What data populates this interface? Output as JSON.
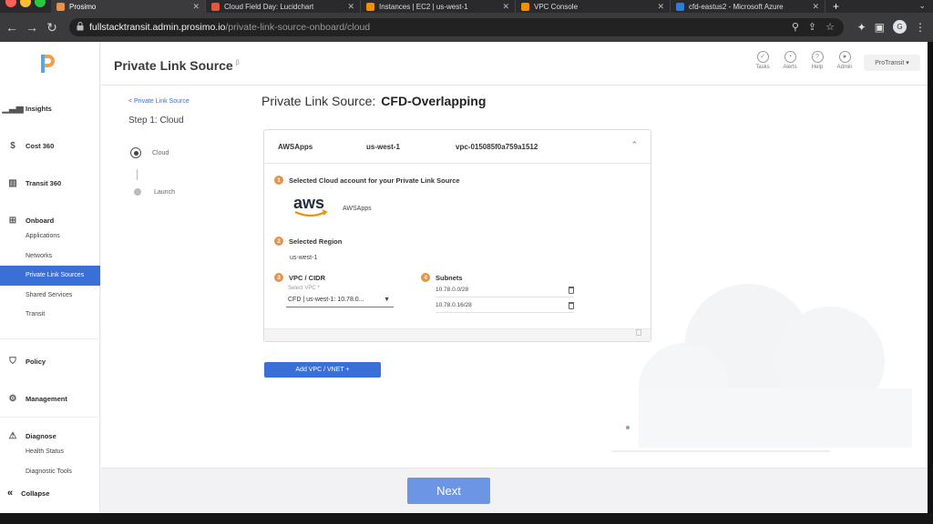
{
  "browser": {
    "tabs": [
      {
        "label": "Prosimo",
        "color": "#e6944a",
        "active": true
      },
      {
        "label": "Cloud Field Day: Lucidchart",
        "color": "#e2583e"
      },
      {
        "label": "Instances | EC2 | us-west-1",
        "color": "#f29100"
      },
      {
        "label": "VPC Console",
        "color": "#f29100"
      },
      {
        "label": "cfd-eastus2 - Microsoft Azure",
        "color": "#2f7bd8"
      }
    ],
    "new_tab": "+",
    "url_host": "fullstacktransit.admin.prosimo.io",
    "url_path": "/private-link-source-onboard/cloud",
    "profile_initial": "G"
  },
  "sidebar": {
    "sections": [
      {
        "label": "Insights",
        "icon": "insights-icon"
      },
      {
        "label": "Cost 360",
        "icon": "dollar-icon"
      },
      {
        "label": "Transit 360",
        "icon": "map-icon"
      },
      {
        "label": "Onboard",
        "icon": "grid-icon"
      },
      {
        "label": "Policy",
        "icon": "shield-icon"
      },
      {
        "label": "Management",
        "icon": "wrench-icon"
      },
      {
        "label": "Diagnose",
        "icon": "warning-icon"
      }
    ],
    "onboard_items": [
      "Applications",
      "Networks",
      "Private Link Sources",
      "Shared Services",
      "Transit"
    ],
    "diagnose_items": [
      "Health Status",
      "Diagnostic Tools"
    ],
    "collapse": "Collapse",
    "active_item": "Private Link Sources"
  },
  "header": {
    "title": "Private Link Source",
    "beta": "β",
    "icons": [
      "Tasks",
      "Alerts",
      "Help",
      "Admin"
    ],
    "tenant": "ProTransit ▾"
  },
  "steps": {
    "back": "< Private Link Source",
    "title": "Step 1: Cloud",
    "items": [
      "Cloud",
      "Launch"
    ]
  },
  "form": {
    "title_prefix": "Private Link Source:",
    "title_name": "CFD-Overlapping",
    "card": {
      "account": "AWSApps",
      "region": "us-west-1",
      "vpc_id": "vpc-015085f0a759a1512"
    },
    "section1": {
      "num": "1",
      "label": "Selected Cloud account for your Private Link Source",
      "logo_text": "aws",
      "account": "AWSApps"
    },
    "section2": {
      "num": "2",
      "label": "Selected Region",
      "value": "us-west-1"
    },
    "section3": {
      "num": "3",
      "label": "VPC / CIDR",
      "select_label": "Select VPC *",
      "select_value": "CFD | us-west-1: 10.78.0..."
    },
    "section4": {
      "num": "4",
      "label": "Subnets",
      "subnets": [
        "10.78.0.0/28",
        "10.78.0.16/28"
      ]
    },
    "add_vpc": "Add VPC / VNET  +",
    "next": "Next"
  },
  "colors": {
    "accent": "#3a6fd8",
    "next": "#6c96e4",
    "step_badge": "#e6944a"
  }
}
